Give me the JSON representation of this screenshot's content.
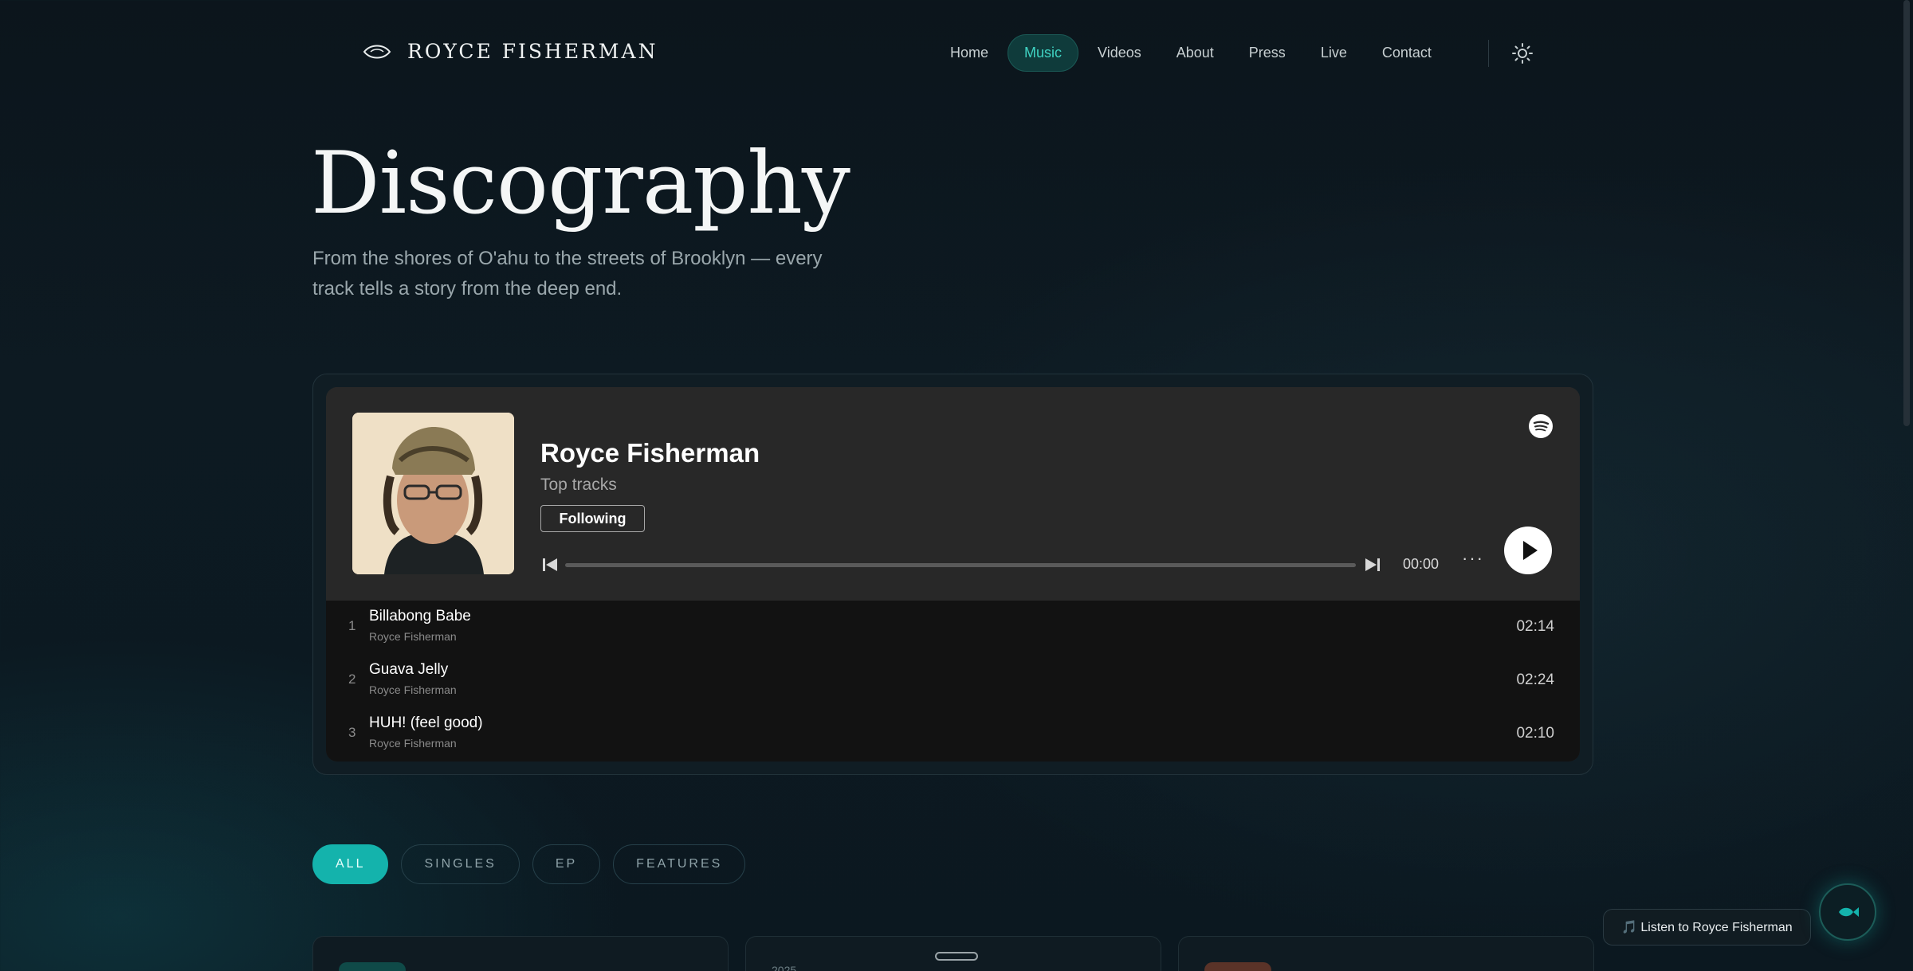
{
  "brand": {
    "name": "ROYCE FISHERMAN",
    "logo_icon": "eye-icon"
  },
  "nav": {
    "items": [
      {
        "label": "Home",
        "active": false
      },
      {
        "label": "Music",
        "active": true
      },
      {
        "label": "Videos",
        "active": false
      },
      {
        "label": "About",
        "active": false
      },
      {
        "label": "Press",
        "active": false
      },
      {
        "label": "Live",
        "active": false
      },
      {
        "label": "Contact",
        "active": false
      }
    ],
    "theme_icon": "sun-icon"
  },
  "hero": {
    "title": "Discography",
    "subtitle": "From the shores of O'ahu to the streets of Brooklyn — every track tells a story from the deep end."
  },
  "player": {
    "artist": "Royce Fisherman",
    "subtitle": "Top tracks",
    "follow_label": "Following",
    "time": "00:00",
    "more_label": "···",
    "tracks": [
      {
        "num": "1",
        "title": "Billabong Babe",
        "artist": "Royce Fisherman",
        "duration": "02:14"
      },
      {
        "num": "2",
        "title": "Guava Jelly",
        "artist": "Royce Fisherman",
        "duration": "02:24"
      },
      {
        "num": "3",
        "title": "HUH! (feel good)",
        "artist": "Royce Fisherman",
        "duration": "02:10"
      }
    ]
  },
  "filters": [
    {
      "label": "ALL",
      "active": true
    },
    {
      "label": "SINGLES",
      "active": false
    },
    {
      "label": "EP",
      "active": false
    },
    {
      "label": "FEATURES",
      "active": false
    }
  ],
  "cards": [
    {
      "year": "",
      "tag_color": "#0f4a48"
    },
    {
      "year": "2025",
      "tag_color": ""
    },
    {
      "year": "",
      "tag_color": "#5a3328"
    }
  ],
  "floating": {
    "listen_label": "🎵 Listen to Royce Fisherman",
    "fab_icon": "fish-icon"
  },
  "colors": {
    "accent": "#14b3ac",
    "background": "#0c151c",
    "player_bg": "#282828"
  }
}
